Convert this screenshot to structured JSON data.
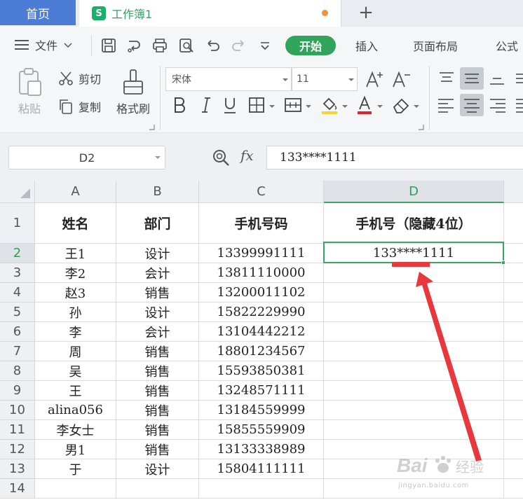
{
  "tabs": {
    "home": "首页",
    "book": "工作簿1",
    "sheet_logo": "S",
    "new_tab": "+"
  },
  "menu": {
    "file": "文件",
    "start": "开始",
    "insert": "插入",
    "page_layout": "页面布局",
    "formula": "公式"
  },
  "ribbon": {
    "paste": "粘贴",
    "cut": "剪切",
    "copy": "复制",
    "format_painter": "格式刷",
    "font_name": "宋体",
    "font_size": "11"
  },
  "formula_bar": {
    "name_box": "D2",
    "fx": "fx",
    "formula": "133****1111"
  },
  "columns": [
    "A",
    "B",
    "C",
    "D"
  ],
  "rows": [
    "1",
    "2",
    "3",
    "4",
    "5",
    "6",
    "7",
    "8",
    "9",
    "10",
    "11",
    "12",
    "13",
    "14"
  ],
  "header": {
    "name": "姓名",
    "dept": "部门",
    "phone": "手机号码",
    "hidden": "手机号（隐藏4位）"
  },
  "records": [
    {
      "name": "王1",
      "dept": "设计",
      "phone": "13399991111",
      "hidden": "133****1111"
    },
    {
      "name": "李2",
      "dept": "会计",
      "phone": "13811110000",
      "hidden": ""
    },
    {
      "name": "赵3",
      "dept": "销售",
      "phone": "13200011102",
      "hidden": ""
    },
    {
      "name": "孙",
      "dept": "设计",
      "phone": "15822229990",
      "hidden": ""
    },
    {
      "name": "李",
      "dept": "会计",
      "phone": "13104442212",
      "hidden": ""
    },
    {
      "name": "周",
      "dept": "销售",
      "phone": "18801234567",
      "hidden": ""
    },
    {
      "name": "吴",
      "dept": "销售",
      "phone": "15593850381",
      "hidden": ""
    },
    {
      "name": "王",
      "dept": "销售",
      "phone": "13248571111",
      "hidden": ""
    },
    {
      "name": "alina056",
      "dept": "销售",
      "phone": "13184559999",
      "hidden": ""
    },
    {
      "name": "李女士",
      "dept": "销售",
      "phone": "15855559909",
      "hidden": ""
    },
    {
      "name": "男1",
      "dept": "销售",
      "phone": "13133338989",
      "hidden": ""
    },
    {
      "name": "于",
      "dept": "设计",
      "phone": "15804111111",
      "hidden": ""
    }
  ],
  "watermark": {
    "brand": "Bai",
    "brand2": "经验",
    "sub": "jingyan.baidu.com"
  },
  "colors": {
    "accent": "#31a45c",
    "home_tab": "#4d7cd6",
    "arrow": "#e8383d"
  }
}
